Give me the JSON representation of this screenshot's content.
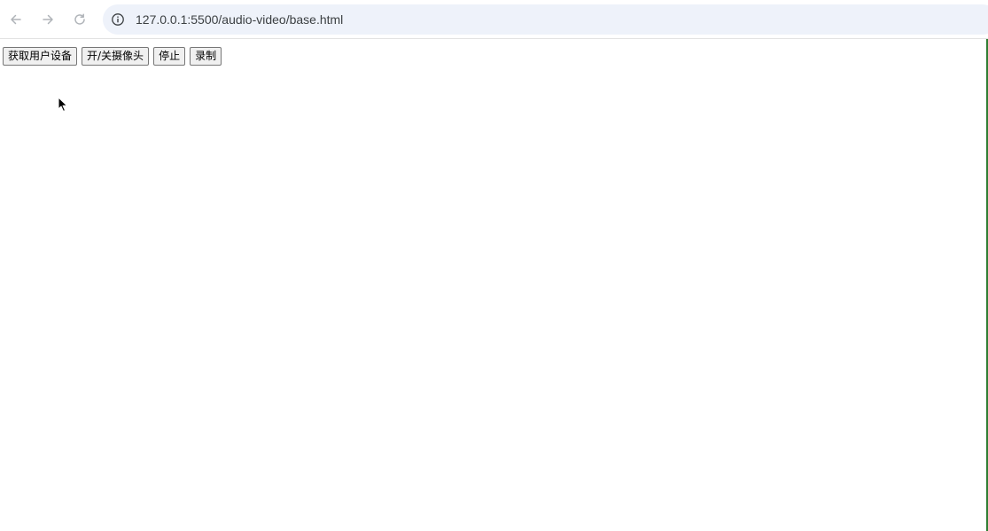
{
  "browser": {
    "url": "127.0.0.1:5500/audio-video/base.html"
  },
  "icons": {
    "back": "arrow-left-icon",
    "forward": "arrow-right-icon",
    "reload": "reload-icon",
    "site_info": "info-icon",
    "cursor": "mouse-pointer-icon"
  },
  "controls": {
    "get_devices_label": "获取用户设备",
    "toggle_camera_label": "开/关摄像头",
    "stop_label": "停止",
    "record_label": "录制"
  },
  "colors": {
    "omnibox_bg": "#eef2fa",
    "edge_accent": "#2e7d32"
  }
}
